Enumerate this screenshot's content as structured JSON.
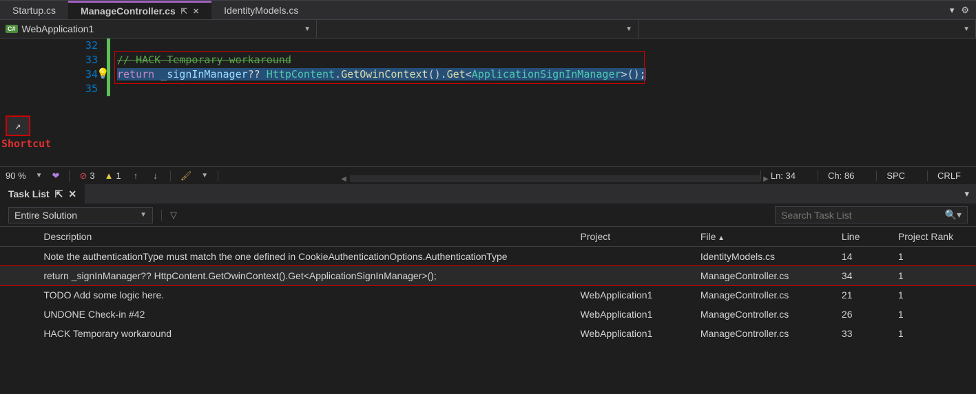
{
  "tabs": [
    {
      "label": "Startup.cs",
      "active": false
    },
    {
      "label": "ManageController.cs",
      "active": true
    },
    {
      "label": "IdentityModels.cs",
      "active": false
    }
  ],
  "nav": {
    "scope": "WebApplication1",
    "type": "",
    "member": ""
  },
  "editor": {
    "lines": {
      "l32": "32",
      "l33": "33",
      "l34": "34",
      "l35": "35"
    },
    "code": {
      "comment": "// HACK Temporary workaround",
      "return_kw": "return",
      "field": " _signInManager",
      "nullcoal": "?? ",
      "type1": "HttpContent",
      "dot1": ".",
      "m1": "GetOwinContext",
      "paren1": "()",
      "dot2": ".",
      "m2": "Get",
      "lt": "<",
      "type2": "ApplicationSignInManager",
      "gt": ">",
      "paren2": "();"
    }
  },
  "annotation": {
    "shortcut": "Shortcut"
  },
  "status": {
    "zoom": "90 %",
    "errors": "3",
    "warnings": "1",
    "line": "Ln: 34",
    "char": "Ch: 86",
    "indent": "SPC",
    "eol": "CRLF"
  },
  "taskList": {
    "panelTitle": "Task List",
    "scope": "Entire Solution",
    "searchPlaceholder": "Search Task List",
    "columns": {
      "description": "Description",
      "project": "Project",
      "file": "File",
      "line": "Line",
      "rank": "Project Rank"
    },
    "rows": [
      {
        "desc": "Note the authenticationType must match the one defined in CookieAuthenticationOptions.AuthenticationType",
        "project": "",
        "file": "IdentityModels.cs",
        "line": "14",
        "rank": "1"
      },
      {
        "desc": "return _signInManager?? HttpContent.GetOwinContext().Get<ApplicationSignInManager>();",
        "project": "",
        "file": "ManageController.cs",
        "line": "34",
        "rank": "1",
        "highlight": true
      },
      {
        "desc": "TODO Add some logic here.",
        "project": "WebApplication1",
        "file": "ManageController.cs",
        "line": "21",
        "rank": "1"
      },
      {
        "desc": "UNDONE Check-in #42",
        "project": "WebApplication1",
        "file": "ManageController.cs",
        "line": "26",
        "rank": "1"
      },
      {
        "desc": "HACK Temporary workaround",
        "project": "WebApplication1",
        "file": "ManageController.cs",
        "line": "33",
        "rank": "1"
      }
    ]
  }
}
